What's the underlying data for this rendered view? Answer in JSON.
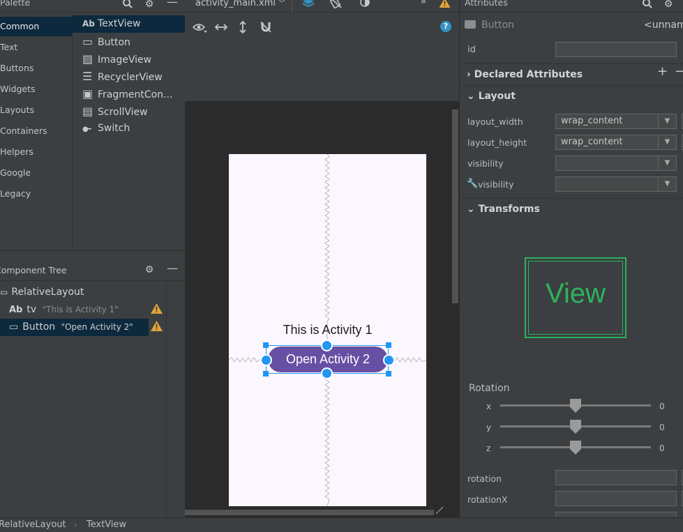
{
  "palette": {
    "title": "Palette",
    "categories": [
      "Common",
      "Text",
      "Buttons",
      "Widgets",
      "Layouts",
      "Containers",
      "Helpers",
      "Google",
      "Legacy"
    ],
    "items": [
      {
        "icon": "Ab",
        "label": "TextView"
      },
      {
        "icon": "▭",
        "label": "Button"
      },
      {
        "icon": "▨",
        "label": "ImageView"
      },
      {
        "icon": "☰",
        "label": "RecyclerView"
      },
      {
        "icon": "▣",
        "label": "FragmentCon..."
      },
      {
        "icon": "▤",
        "label": "ScrollView"
      },
      {
        "icon": "●━",
        "label": "Switch"
      }
    ]
  },
  "component_tree": {
    "title": "Component Tree",
    "rows": [
      {
        "icon": "▭",
        "label": "RelativeLayout",
        "hint": ""
      },
      {
        "icon": "Ab",
        "label": "tv",
        "hint": "\"This is Activity 1\""
      },
      {
        "icon": "▭",
        "label": "Button",
        "hint": "\"Open Activity 2\""
      }
    ]
  },
  "editor": {
    "tab_label": "activity_main.xml",
    "help": "?",
    "device_text": "This is Activity 1",
    "device_button": "Open Activity 2"
  },
  "attributes": {
    "title": "Attributes",
    "component_type": "Button",
    "component_name": "<unnamed>",
    "id_label": "id",
    "id_value": "",
    "declared_section": "Declared Attributes",
    "layout_section": "Layout",
    "layout_rows": [
      {
        "label": "layout_width",
        "value": "wrap_content"
      },
      {
        "label": "layout_height",
        "value": "wrap_content"
      },
      {
        "label": "visibility",
        "value": ""
      },
      {
        "label": "visibility",
        "value": ""
      }
    ],
    "transforms_section": "Transforms",
    "preview_text": "View",
    "rotation_label": "Rotation",
    "rotation_axes": [
      {
        "axis": "x",
        "value": "0"
      },
      {
        "axis": "y",
        "value": "0"
      },
      {
        "axis": "z",
        "value": "0"
      }
    ],
    "extra_rows": [
      {
        "label": "rotation",
        "value": ""
      },
      {
        "label": "rotationX",
        "value": ""
      }
    ]
  },
  "statusbar": {
    "crumbs": [
      "RelativeLayout",
      "TextView"
    ]
  },
  "colors": {
    "accent_button": "#6750a4",
    "selection_handle": "#2196f3",
    "warning": "#e3a43a",
    "preview_green": "#2db35c"
  }
}
